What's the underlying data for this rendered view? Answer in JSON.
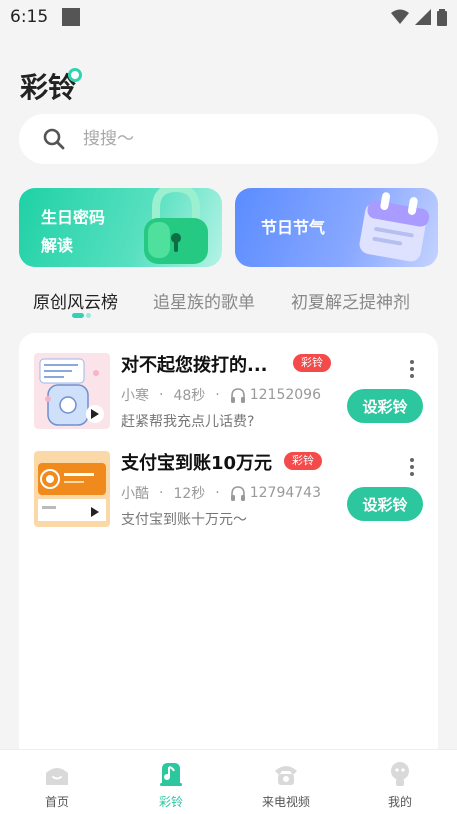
{
  "status_bar": {
    "time": "6:15"
  },
  "app": {
    "title": "彩铃"
  },
  "search": {
    "placeholder": "搜搜～"
  },
  "banners": [
    {
      "line1": "生日密码",
      "line2": "解读"
    },
    {
      "line1": "节日节气"
    }
  ],
  "tabs": [
    {
      "label": "原创风云榜",
      "active": true
    },
    {
      "label": "追星族的歌单"
    },
    {
      "label": "初夏解乏提神剂"
    }
  ],
  "songs": [
    {
      "title": "对不起您拨打的...",
      "badge": "彩铃",
      "artist": "小寒",
      "duration": "48秒",
      "plays": "12152096",
      "desc": "赶紧帮我充点儿话费?",
      "button": "设彩铃"
    },
    {
      "title": "支付宝到账10万元",
      "badge": "彩铃",
      "artist": "小酷",
      "duration": "12秒",
      "plays": "12794743",
      "desc": "支付宝到账十万元～",
      "button": "设彩铃"
    }
  ],
  "nav": [
    {
      "label": "首页",
      "icon": "home-icon"
    },
    {
      "label": "彩铃",
      "icon": "ringtone-icon",
      "active": true
    },
    {
      "label": "来电视频",
      "icon": "phone-icon"
    },
    {
      "label": "我的",
      "icon": "profile-icon"
    }
  ],
  "colors": {
    "accent": "#2cc69f",
    "badge": "#f54a4a"
  }
}
